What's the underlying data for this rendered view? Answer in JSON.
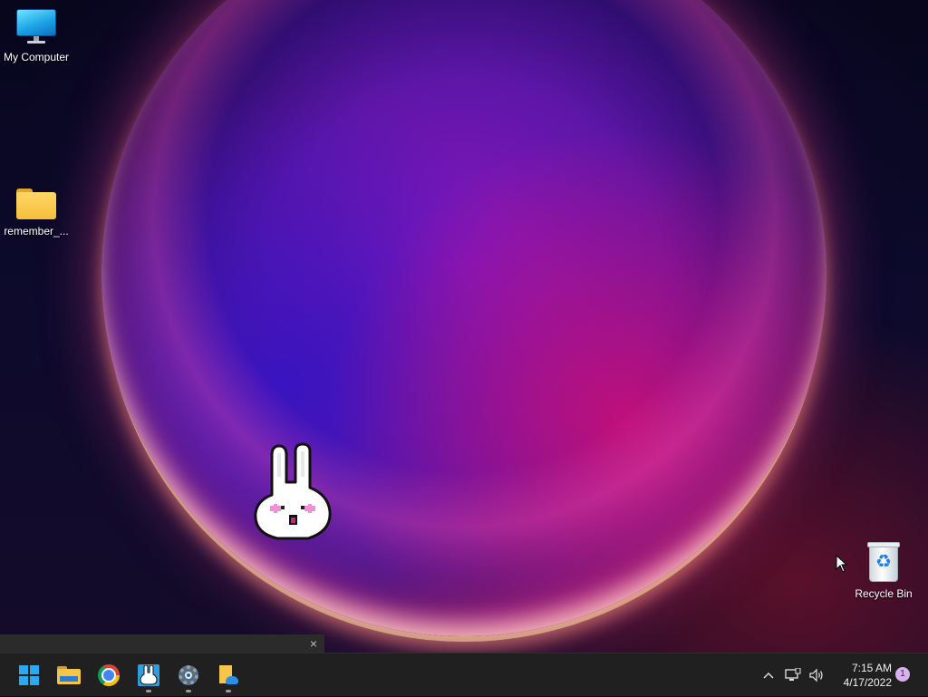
{
  "desktop": {
    "icons": [
      {
        "label": "My Computer",
        "icon": "computer-icon"
      },
      {
        "label": "remember_...",
        "icon": "folder-icon"
      },
      {
        "label": "Recycle Bin",
        "icon": "recycle-bin-icon"
      }
    ]
  },
  "notification_strip": {
    "close_glyph": "×"
  },
  "taskbar": {
    "apps": [
      {
        "name": "Start",
        "icon": "windows-start-icon",
        "running": false
      },
      {
        "name": "File Explorer",
        "icon": "file-explorer-icon",
        "running": false
      },
      {
        "name": "Google Chrome",
        "icon": "chrome-icon",
        "running": false
      },
      {
        "name": "Bunny app",
        "icon": "bunny-app-icon",
        "running": true
      },
      {
        "name": "Settings",
        "icon": "settings-gear-icon",
        "running": true
      },
      {
        "name": "Files",
        "icon": "folder-cloud-icon",
        "running": true
      }
    ],
    "tray": {
      "chevron_glyph": "^",
      "volume_glyph": "🔊",
      "time": "7:15 AM",
      "date": "4/17/2022",
      "notification_count": "1"
    }
  },
  "colors": {
    "taskbar_bg": "#202020",
    "start_accent": "#2aa8f2",
    "wallpaper_sphere": "#8d17c0",
    "notification_badge": "#d8b2ec"
  }
}
